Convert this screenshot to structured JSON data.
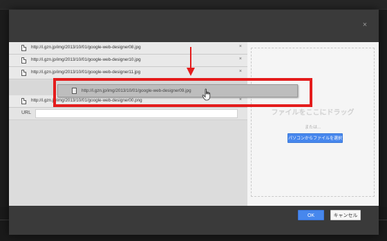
{
  "dialog": {
    "close_label": "×",
    "files": [
      {
        "name": "http://i.gzn.jp/img/2013/10/01/google-web-designer08.jpg",
        "remove_label": "×"
      },
      {
        "name": "http://i.gzn.jp/img/2013/10/01/google-web-designer10.jpg",
        "remove_label": "×"
      },
      {
        "name": "http://i.gzn.jp/img/2013/10/01/google-web-designer11.jpg",
        "remove_label": "×"
      },
      {
        "name": "http://i.gzn.jp/img/2013/10/01/google-web-designer00.png",
        "remove_label": "×"
      }
    ],
    "dragging_file": "http://i.gzn.jp/img/2013/10/01/google-web-designer09.jpg",
    "url_label": "URL",
    "url_value": "",
    "drop_zone": {
      "title": "ファイルをここにドラッグ",
      "or_text": "または...",
      "select_button": "パソコンからファイルを選択"
    },
    "ok_label": "OK",
    "cancel_label": "キャンセル"
  },
  "colors": {
    "accent": "#4787ed",
    "highlight": "#e41c1c"
  },
  "icons": [
    "file-icon",
    "close-icon",
    "down-arrow-annotation",
    "hand-cursor-icon"
  ]
}
